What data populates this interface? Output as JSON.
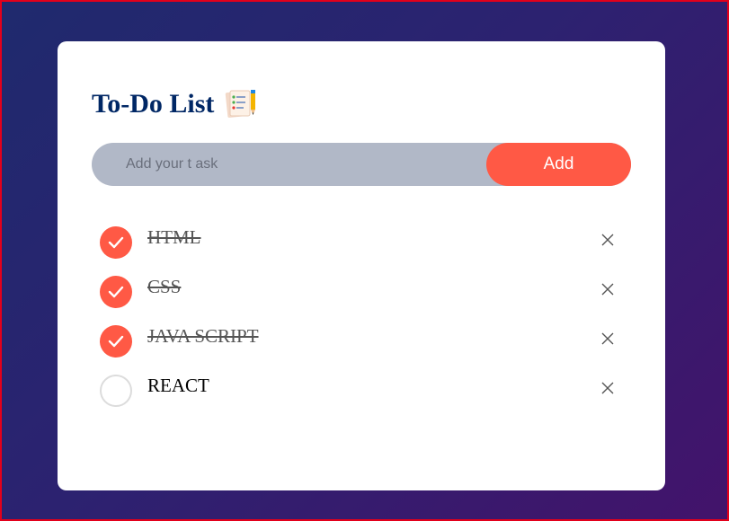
{
  "app": {
    "title": "To-Do List",
    "title_icon": "notepad-checklist-icon"
  },
  "input": {
    "placeholder": "Add your t ask",
    "value": ""
  },
  "add_button": {
    "label": "Add"
  },
  "colors": {
    "accent": "#ff5945",
    "title": "#002765",
    "input_bg": "#b1b8c7"
  },
  "tasks": [
    {
      "text": "HTML",
      "completed": true,
      "delete_icon": "close-icon"
    },
    {
      "text": "CSS",
      "completed": true,
      "delete_icon": "close-icon"
    },
    {
      "text": "JAVA SCRIPT",
      "completed": true,
      "delete_icon": "close-icon"
    },
    {
      "text": "REACT",
      "completed": false,
      "delete_icon": "close-icon"
    }
  ]
}
